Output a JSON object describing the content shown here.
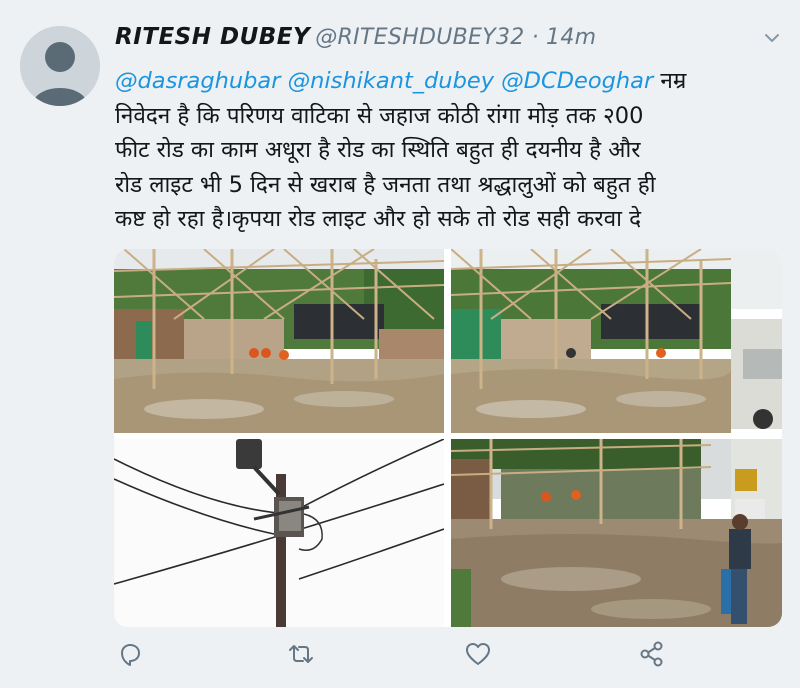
{
  "tweet": {
    "display_name": "RITESH DUBEY",
    "handle": "@RITESHDUBEY32",
    "separator": "·",
    "time": "14m",
    "body_lines": [
      {
        "mentions": [
          "@dasraghubar",
          "@nishikant_dubey",
          "@DCDeoghar"
        ],
        "text": "नम्र"
      },
      {
        "text": "निवेदन है कि परिणय वाटिका से जहाज कोठी रांगा मोड़ तक २00"
      },
      {
        "text": "फीट रोड का काम अधूरा है रोड का स्थिति बहुत ही दयनीय है और"
      },
      {
        "text": "रोड लाइट भी 5 दिन से खराब है जनता तथा श्रद्धालुओं को बहुत ही"
      },
      {
        "text": "कष्ट हो रहा है।कृपया रोड लाइट और हो सके तो रोड सही करवा दे"
      }
    ],
    "media_count": 4
  },
  "colors": {
    "background": "#eef1f3",
    "text": "#14171a",
    "secondary": "#657786",
    "link": "#1b95e0"
  },
  "icons": {
    "avatar": "default-avatar-icon",
    "menu": "chevron-down-icon",
    "reply": "reply-icon",
    "retweet": "retweet-icon",
    "like": "heart-icon",
    "share": "share-icon"
  }
}
